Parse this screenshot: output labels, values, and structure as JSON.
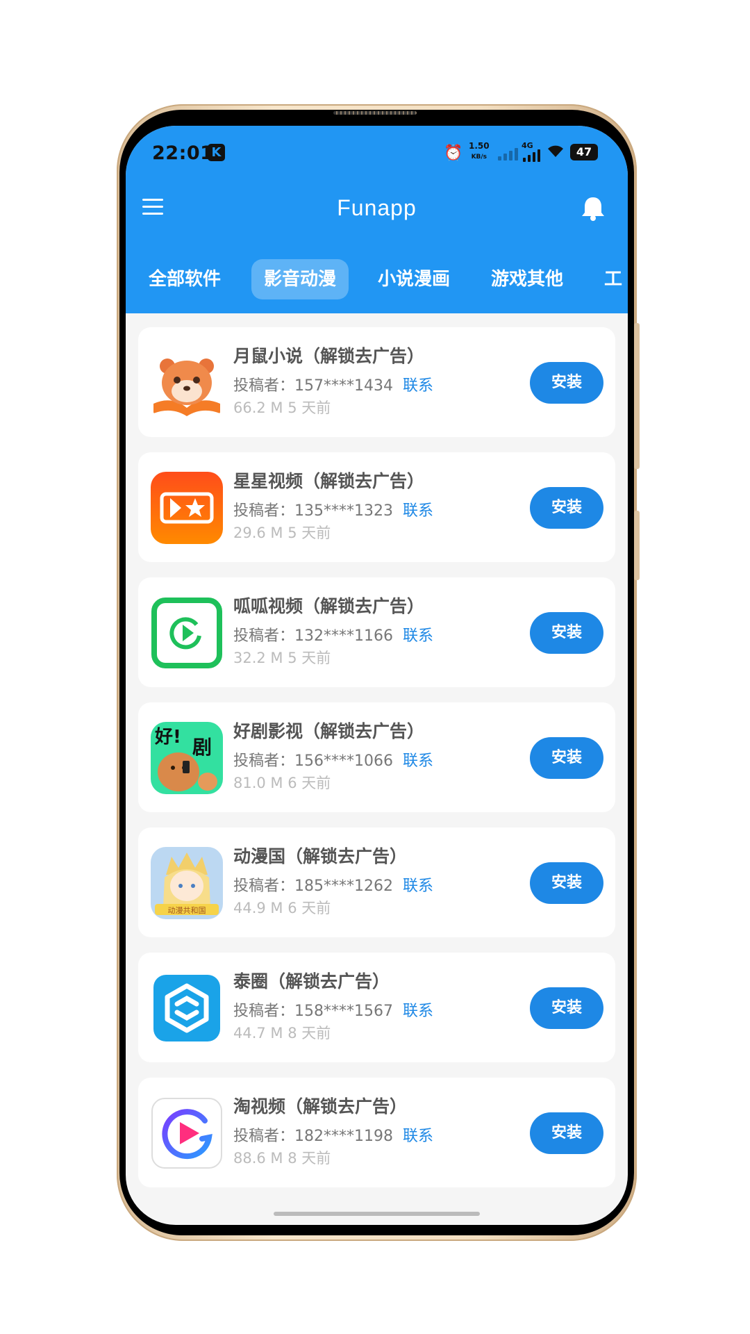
{
  "status_bar": {
    "time": "22:01",
    "k_badge": "K",
    "speed_value": "1.50",
    "speed_unit": "KB/s",
    "network": "4G",
    "battery": "47"
  },
  "header": {
    "title": "Funapp",
    "menu_icon": "hamburger-icon",
    "bell_icon": "bell-icon"
  },
  "tabs": [
    {
      "label": "全部软件",
      "active": false
    },
    {
      "label": "影音动漫",
      "active": true
    },
    {
      "label": "小说漫画",
      "active": false
    },
    {
      "label": "游戏其他",
      "active": false
    },
    {
      "label": "工",
      "active": false
    }
  ],
  "apps": [
    {
      "name": "月鼠小说（解锁去广告）",
      "uploader": "投稿者：157****1434",
      "contact": "联系",
      "size": "66.2 M",
      "time": "5 天前",
      "install": "安装",
      "icon": "hamster-book-icon"
    },
    {
      "name": "星星视频（解锁去广告）",
      "uploader": "投稿者：135****1323",
      "contact": "联系",
      "size": "29.6 M",
      "time": "5 天前",
      "install": "安装",
      "icon": "star-video-icon"
    },
    {
      "name": "呱呱视频（解锁去广告）",
      "uploader": "投稿者：132****1166",
      "contact": "联系",
      "size": "32.2 M",
      "time": "5 天前",
      "install": "安装",
      "icon": "green-play-icon"
    },
    {
      "name": "好剧影视（解锁去广告）",
      "uploader": "投稿者：156****1066",
      "contact": "联系",
      "size": "81.0 M",
      "time": "6 天前",
      "install": "安装",
      "icon": "haoju-icon"
    },
    {
      "name": "动漫国（解锁去广告）",
      "uploader": "投稿者：185****1262",
      "contact": "联系",
      "size": "44.9 M",
      "time": "6 天前",
      "install": "安装",
      "icon": "anime-girl-icon"
    },
    {
      "name": "泰圈（解锁去广告）",
      "uploader": "投稿者：158****1567",
      "contact": "联系",
      "size": "44.7 M",
      "time": "8 天前",
      "install": "安装",
      "icon": "hexagon-logo-icon"
    },
    {
      "name": "淘视频（解锁去广告）",
      "uploader": "投稿者：182****1198",
      "contact": "联系",
      "size": "88.6 M",
      "time": "8 天前",
      "install": "安装",
      "icon": "tao-video-icon"
    }
  ],
  "icon_texts": {
    "haoju_1": "好!",
    "haoju_2": "剧",
    "anime_banner": "动漫共和国"
  },
  "colors": {
    "header_blue": "#2196f3",
    "button_blue": "#1e88e5",
    "background": "#f5f5f5"
  }
}
